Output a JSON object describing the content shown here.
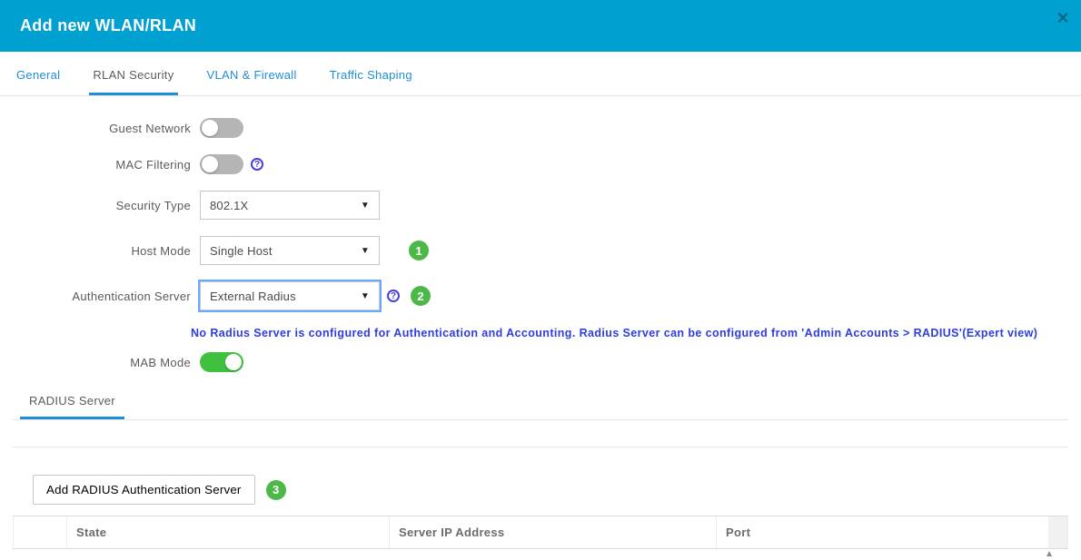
{
  "header": {
    "title": "Add new WLAN/RLAN"
  },
  "tabs": {
    "general": "General",
    "rlan_security": "RLAN Security",
    "vlan_firewall": "VLAN & Firewall",
    "traffic_shaping": "Traffic Shaping"
  },
  "form": {
    "guest_network_label": "Guest Network",
    "mac_filtering_label": "MAC Filtering",
    "security_type_label": "Security Type",
    "security_type_value": "802.1X",
    "host_mode_label": "Host Mode",
    "host_mode_value": "Single Host",
    "auth_server_label": "Authentication Server",
    "auth_server_value": "External Radius",
    "mab_mode_label": "MAB Mode"
  },
  "callouts": {
    "one": "1",
    "two": "2",
    "three": "3"
  },
  "warning": "No Radius Server is configured for Authentication and Accounting. Radius Server can be configured from 'Admin Accounts > RADIUS'(Expert view)",
  "subtabs": {
    "radius_server": "RADIUS Server"
  },
  "actions": {
    "add_radius_btn": "Add RADIUS Authentication Server"
  },
  "table": {
    "cols": {
      "state": "State",
      "server_ip": "Server IP Address",
      "port": "Port"
    }
  }
}
